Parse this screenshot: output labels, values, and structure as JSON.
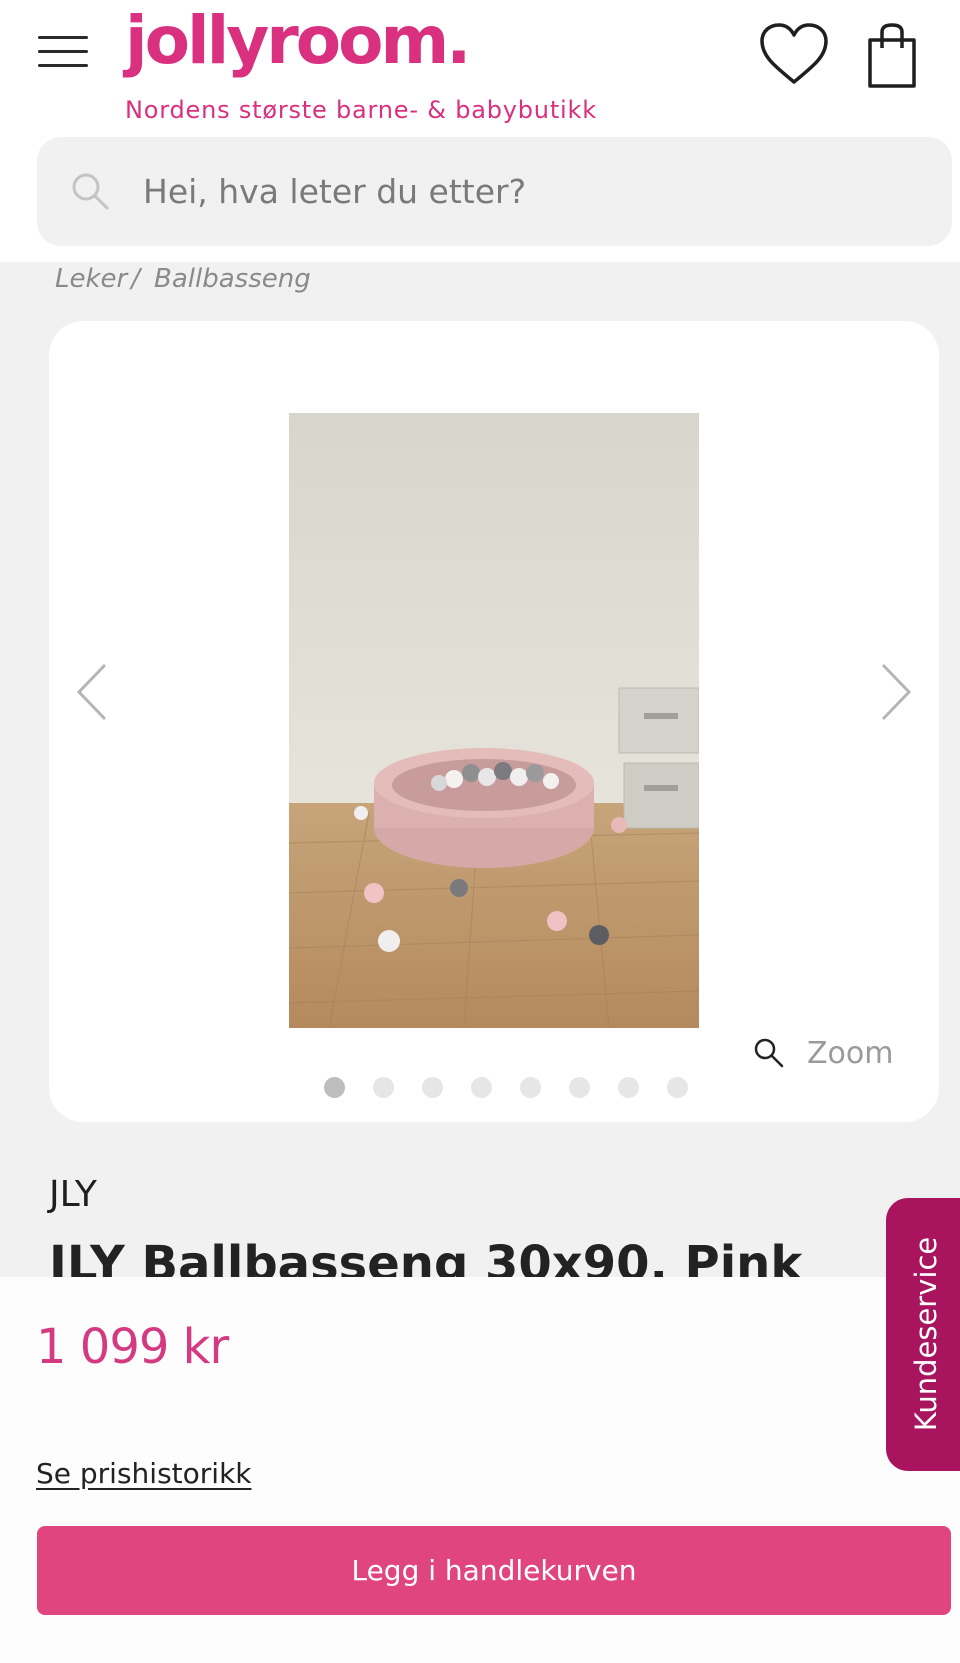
{
  "colors": {
    "brand_pink": "#d9307f",
    "price_pink": "#d43a82",
    "cart_button": "#e0457f",
    "kundeservice_bg": "#a8155e"
  },
  "header": {
    "logo_text": "jollyroom.",
    "tagline": "Nordens største barne- & babybutikk",
    "icons": [
      "menu-icon",
      "heart-icon",
      "shopping-bag-icon"
    ]
  },
  "search": {
    "placeholder": "Hei, hva leter du etter?",
    "icon": "search-icon"
  },
  "breadcrumb": {
    "items": [
      "Leker",
      "Ballbasseng"
    ],
    "separator": "/"
  },
  "gallery": {
    "image_alt": "JLY Ballbasseng 30x90, Pink",
    "zoom_label": "Zoom",
    "image_count": 8,
    "active_index": 0,
    "icons": [
      "chevron-left-icon",
      "chevron-right-icon",
      "zoom-icon"
    ]
  },
  "product": {
    "brand": "JLY",
    "title": "JLY Ballbasseng 30x90, Pink",
    "price": "1 099 kr",
    "price_history_link": "Se prishistorikk",
    "add_to_cart_label": "Legg i handlekurven"
  },
  "kundeservice": {
    "label": "Kundeservice"
  }
}
